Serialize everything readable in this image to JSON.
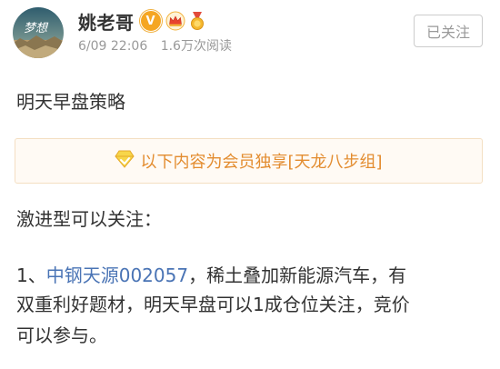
{
  "header": {
    "avatar_text": "梦想",
    "username": "姚老哥",
    "verified_badge": "V",
    "date": "6/09 22:06",
    "views": "1.6万次阅读",
    "follow_button": "已关注",
    "icons": [
      "avatar",
      "verified-v-icon",
      "crown-icon",
      "medal-icon"
    ]
  },
  "post": {
    "title": "明天早盘策略",
    "vip_notice": "以下内容为会员独享[天龙八步组]",
    "line1": "激进型可以关注：",
    "item_prefix": "1、",
    "stock_link": "中钢天源002057",
    "item_rest": "，稀土叠加新能源汽车，有",
    "line3": "双重利好题材，明天早盘可以1成仓位关注，竞价",
    "line4": "可以参与。"
  },
  "colors": {
    "link": "#4a74b5",
    "vip_text": "#e38c2f",
    "vip_border": "#f4dfc2",
    "vip_bg": "#fffaf4",
    "badge": "#f5a623"
  }
}
